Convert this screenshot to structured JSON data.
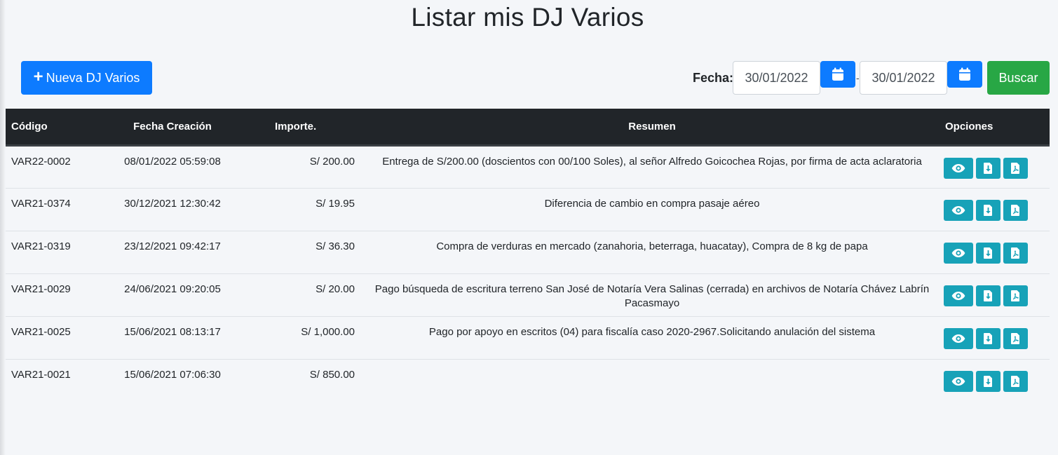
{
  "page": {
    "title": "Listar mis DJ Varios"
  },
  "toolbar": {
    "new_label": "Nueva DJ Varios",
    "fecha_label": "Fecha:",
    "date_from": "30/01/2022",
    "date_to": "30/01/2022",
    "separator": "-",
    "search_label": "Buscar"
  },
  "table": {
    "headers": {
      "codigo": "Código",
      "fecha": "Fecha Creación",
      "importe": "Importe.",
      "resumen": "Resumen",
      "opciones": "Opciones"
    },
    "rows": [
      {
        "codigo": "VAR22-0002",
        "fecha": "08/01/2022 05:59:08",
        "importe": "S/ 200.00",
        "resumen": "Entrega de S/200.00 (doscientos con 00/100 Soles), al señor Alfredo Goicochea Rojas, por firma de acta aclaratoria"
      },
      {
        "codigo": "VAR21-0374",
        "fecha": "30/12/2021 12:30:42",
        "importe": "S/ 19.95",
        "resumen": "Diferencia de cambio en compra pasaje aéreo"
      },
      {
        "codigo": "VAR21-0319",
        "fecha": "23/12/2021 09:42:17",
        "importe": "S/ 36.30",
        "resumen": "Compra de verduras en mercado (zanahoria, beterraga, huacatay), Compra de 8 kg de papa"
      },
      {
        "codigo": "VAR21-0029",
        "fecha": "24/06/2021 09:20:05",
        "importe": "S/ 20.00",
        "resumen": "Pago búsqueda de escritura terreno San José de Notaría Vera Salinas (cerrada) en archivos de Notaría Chávez Labrín Pacasmayo"
      },
      {
        "codigo": "VAR21-0025",
        "fecha": "15/06/2021 08:13:17",
        "importe": "S/ 1,000.00",
        "resumen": "Pago por apoyo en escritos (04) para fiscalía caso 2020-2967.Solicitando anulación del sistema"
      },
      {
        "codigo": "VAR21-0021",
        "fecha": "15/06/2021 07:06:30",
        "importe": "S/ 850.00",
        "resumen": ""
      }
    ],
    "row_actions": [
      "view-icon",
      "download-icon",
      "pdf-icon"
    ]
  },
  "colors": {
    "primary": "#0d7bff",
    "success": "#28a745",
    "info": "#17a2b8",
    "header_bg": "#212529",
    "page_bg": "#f4f6f9"
  }
}
